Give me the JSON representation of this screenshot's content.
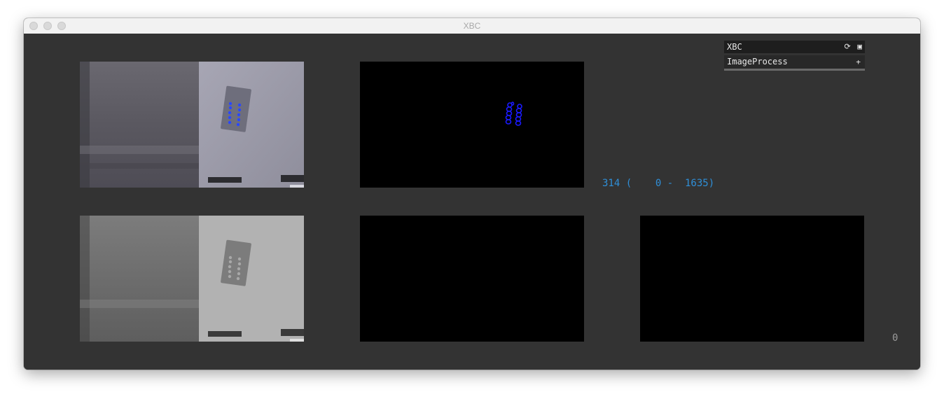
{
  "window": {
    "title": "XBC"
  },
  "gui": {
    "title": "XBC",
    "icons": [
      "refresh-icon",
      "save-icon"
    ],
    "refresh_glyph": "⟳",
    "save_glyph": "▣",
    "group_label": "ImageProcess",
    "group_toggle": "+"
  },
  "readout": {
    "value": "314",
    "range_min": "0",
    "range_max": "1635",
    "text": "314 (    0 -  1635)"
  },
  "counter": "0",
  "panels": [
    "color-camera",
    "blob-detection",
    "grayscale-camera",
    "empty-view",
    "empty-view"
  ],
  "colors": {
    "background": "#333333",
    "readout": "#2f8fd8",
    "blob": "#1a1aff"
  }
}
